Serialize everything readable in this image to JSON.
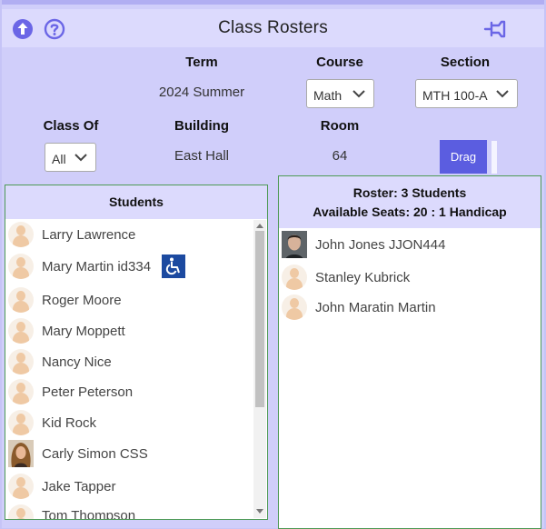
{
  "window": {
    "title": "Class Rosters"
  },
  "fields": {
    "term": {
      "label": "Term",
      "value": "2024 Summer"
    },
    "course": {
      "label": "Course",
      "value": "Math"
    },
    "section": {
      "label": "Section",
      "value": "MTH 100-A"
    },
    "class_of": {
      "label": "Class Of",
      "value": "All"
    },
    "building": {
      "label": "Building",
      "value": "East Hall"
    },
    "room": {
      "label": "Room",
      "value": "64"
    }
  },
  "drag_button": {
    "label": "Drag"
  },
  "students_panel": {
    "title": "Students",
    "items": [
      {
        "name": "Larry Lawrence",
        "avatar": "placeholder"
      },
      {
        "name": "Mary Martin id334",
        "avatar": "placeholder",
        "badge": "wheelchair-icon"
      },
      {
        "name": "Roger Moore",
        "avatar": "placeholder"
      },
      {
        "name": "Mary Moppett",
        "avatar": "placeholder"
      },
      {
        "name": "Nancy Nice",
        "avatar": "placeholder"
      },
      {
        "name": "Peter Peterson",
        "avatar": "placeholder"
      },
      {
        "name": "Kid Rock",
        "avatar": "placeholder"
      },
      {
        "name": "Carly Simon CSS",
        "avatar": "photo"
      },
      {
        "name": "Jake Tapper",
        "avatar": "placeholder"
      },
      {
        "name": "Tom Thompson",
        "avatar": "placeholder"
      }
    ]
  },
  "roster_panel": {
    "title": "Roster: 3 Students",
    "subtitle": "Available Seats: 20 : 1 Handicap",
    "items": [
      {
        "name": "John Jones JJON444",
        "avatar": "photo"
      },
      {
        "name": "Stanley Kubrick",
        "avatar": "placeholder"
      },
      {
        "name": "John Maratin Martin",
        "avatar": "placeholder"
      }
    ]
  },
  "colors": {
    "accent": "#5b5de0",
    "header_bg": "#dcdafd",
    "panel_border": "#4e9a56",
    "handicap_badge": "#1c4aa0"
  }
}
